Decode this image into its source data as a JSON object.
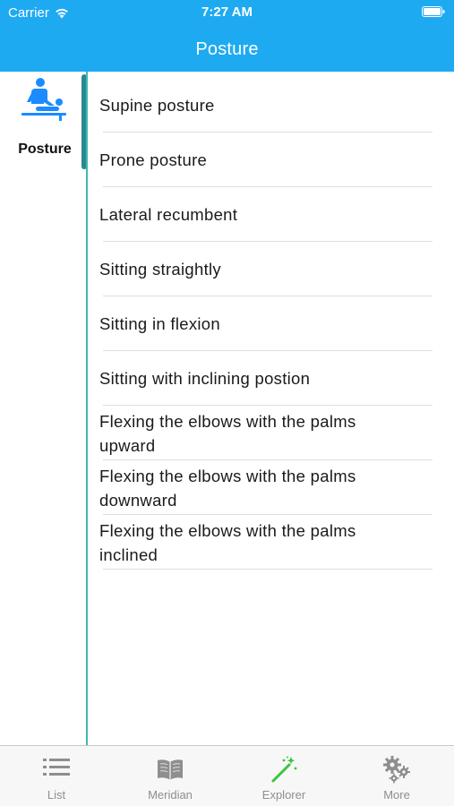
{
  "status_bar": {
    "carrier": "Carrier",
    "time": "7:27 AM"
  },
  "nav": {
    "title": "Posture"
  },
  "category": {
    "label": "Posture",
    "icon": "massage-table-icon",
    "accent_color": "#1a8cff"
  },
  "postures": [
    {
      "label": "Supine posture"
    },
    {
      "label": "Prone posture"
    },
    {
      "label": "Lateral recumbent"
    },
    {
      "label": "Sitting straightly"
    },
    {
      "label": "Sitting in flexion"
    },
    {
      "label": "Sitting with inclining postion"
    },
    {
      "label": "Flexing the elbows with the palms upward"
    },
    {
      "label": "Flexing the elbows with the palms downward"
    },
    {
      "label": "Flexing the elbows with the palms inclined"
    }
  ],
  "tabs": [
    {
      "label": "List",
      "icon": "list-icon",
      "selected": false
    },
    {
      "label": "Meridian",
      "icon": "book-icon",
      "selected": false
    },
    {
      "label": "Explorer",
      "icon": "magic-wand-icon",
      "selected": true
    },
    {
      "label": "More",
      "icon": "gears-icon",
      "selected": false
    }
  ],
  "colors": {
    "header": "#1eaaf1",
    "divider": "#3fb9b1",
    "active_indicator": "#2a8891",
    "explorer_icon": "#3cc33c"
  }
}
